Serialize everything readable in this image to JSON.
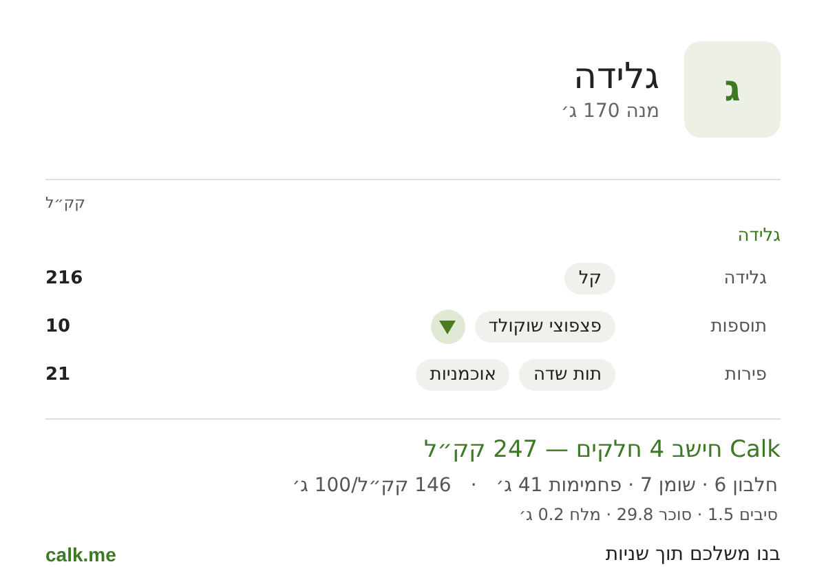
{
  "header": {
    "letter": "ג",
    "title": "גלידה",
    "serving": "מנה 170 ג׳"
  },
  "unit_label": "קק״ל",
  "section_title": "גלידה",
  "rows": [
    {
      "label": "גלידה",
      "chips": [
        "קל"
      ],
      "dropdown": false,
      "value": "216"
    },
    {
      "label": "תוספות",
      "chips": [
        "פצפוצי שוקולד"
      ],
      "dropdown": true,
      "value": "10"
    },
    {
      "label": "פירות",
      "chips": [
        "תות שדה",
        "אוכמניות"
      ],
      "dropdown": false,
      "value": "21"
    }
  ],
  "summary": {
    "headline": "Calk חישב 4 חלקים — 247 קק״ל",
    "macros": "חלבון 6 · שומן 7 · פחמימות 41 ג׳",
    "separator": "·",
    "density": "146 קק״ל/100 ג׳",
    "details": "סיבים 1.5 · סוכר 29.8 · מלח 0.2 ג׳"
  },
  "footer": {
    "tagline": "בנו משלכם תוך שניות",
    "link": "calk.me"
  }
}
